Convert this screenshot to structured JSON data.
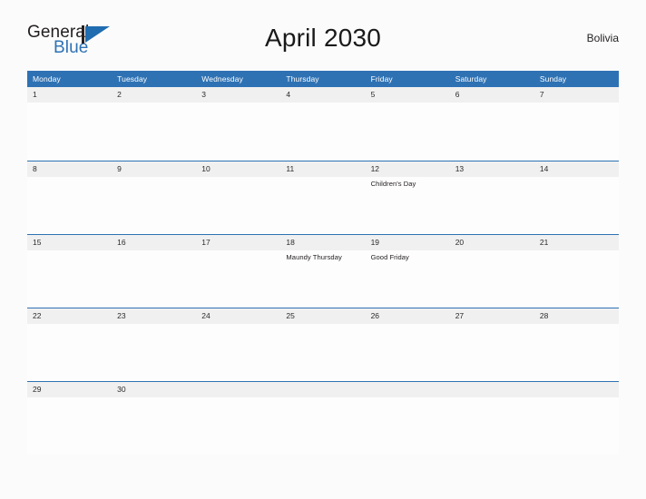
{
  "brand": {
    "name_top": "General",
    "name_bottom": "Blue",
    "logo_mark": "triangle-flag-icon",
    "color_blue": "#2e72b4",
    "color_dark": "#231f20"
  },
  "header": {
    "title": "April 2030",
    "country": "Bolivia"
  },
  "calendar": {
    "weekdays": [
      "Monday",
      "Tuesday",
      "Wednesday",
      "Thursday",
      "Friday",
      "Saturday",
      "Sunday"
    ],
    "weeks": [
      {
        "days": [
          {
            "num": "1",
            "events": []
          },
          {
            "num": "2",
            "events": []
          },
          {
            "num": "3",
            "events": []
          },
          {
            "num": "4",
            "events": []
          },
          {
            "num": "5",
            "events": []
          },
          {
            "num": "6",
            "events": []
          },
          {
            "num": "7",
            "events": []
          }
        ]
      },
      {
        "days": [
          {
            "num": "8",
            "events": []
          },
          {
            "num": "9",
            "events": []
          },
          {
            "num": "10",
            "events": []
          },
          {
            "num": "11",
            "events": []
          },
          {
            "num": "12",
            "events": [
              "Children's Day"
            ]
          },
          {
            "num": "13",
            "events": []
          },
          {
            "num": "14",
            "events": []
          }
        ]
      },
      {
        "days": [
          {
            "num": "15",
            "events": []
          },
          {
            "num": "16",
            "events": []
          },
          {
            "num": "17",
            "events": []
          },
          {
            "num": "18",
            "events": [
              "Maundy Thursday"
            ]
          },
          {
            "num": "19",
            "events": [
              "Good Friday"
            ]
          },
          {
            "num": "20",
            "events": []
          },
          {
            "num": "21",
            "events": []
          }
        ]
      },
      {
        "days": [
          {
            "num": "22",
            "events": []
          },
          {
            "num": "23",
            "events": []
          },
          {
            "num": "24",
            "events": []
          },
          {
            "num": "25",
            "events": []
          },
          {
            "num": "26",
            "events": []
          },
          {
            "num": "27",
            "events": []
          },
          {
            "num": "28",
            "events": []
          }
        ]
      },
      {
        "days": [
          {
            "num": "29",
            "events": []
          },
          {
            "num": "30",
            "events": []
          },
          {
            "num": "",
            "events": []
          },
          {
            "num": "",
            "events": []
          },
          {
            "num": "",
            "events": []
          },
          {
            "num": "",
            "events": []
          },
          {
            "num": "",
            "events": []
          }
        ]
      }
    ]
  }
}
